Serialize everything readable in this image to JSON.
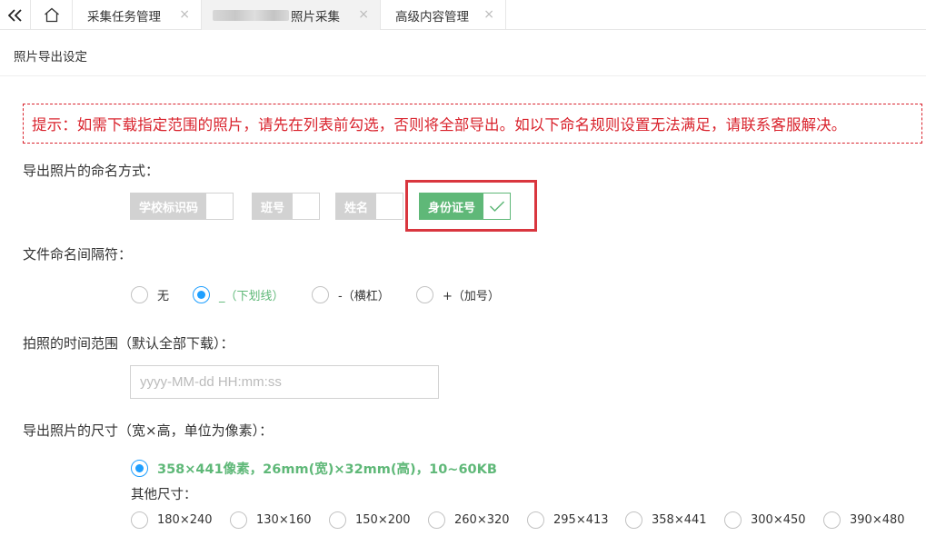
{
  "tabs": {
    "collapse_icon": "double-chevron-left-icon",
    "home_icon": "home-icon",
    "items": [
      {
        "label": "采集任务管理",
        "close": "×"
      },
      {
        "label": "照片采集",
        "close": "×"
      },
      {
        "label": "高级内容管理",
        "close": "×"
      }
    ]
  },
  "header": {
    "title": "照片导出设定"
  },
  "notice": {
    "text": "提示：如需下载指定范围的照片，请先在列表前勾选，否则将全部导出。如以下命名规则设置无法满足，请联系客服解决。",
    "color": "#d9232d"
  },
  "naming": {
    "label": "导出照片的命名方式：",
    "options": [
      {
        "label": "学校标识码",
        "on": false
      },
      {
        "label": "班号",
        "on": false
      },
      {
        "label": "姓名",
        "on": false
      },
      {
        "label": "身份证号",
        "on": true
      }
    ],
    "on_color": "#5fb878"
  },
  "separator": {
    "label": "文件命名间隔符：",
    "options": [
      "无",
      "_（下划线）",
      "-（横杠）",
      "+（加号）"
    ],
    "selected": "_（下划线）"
  },
  "time_range": {
    "label": "拍照的时间范围（默认全部下载）：",
    "placeholder": "yyyy-MM-dd HH:mm:ss"
  },
  "size": {
    "label": "导出照片的尺寸（宽×高，单位为像素）：",
    "main_option": "358×441像素，26mm(宽)×32mm(高)，10~60KB",
    "other_label": "其他尺寸：",
    "other_options": [
      "180×240",
      "130×160",
      "150×200",
      "260×320",
      "295×413",
      "358×441",
      "300×450",
      "390×480"
    ]
  },
  "colors": {
    "accent": "#1e9fff",
    "checked_text": "#5fb878",
    "highlight": "#d9363e"
  }
}
